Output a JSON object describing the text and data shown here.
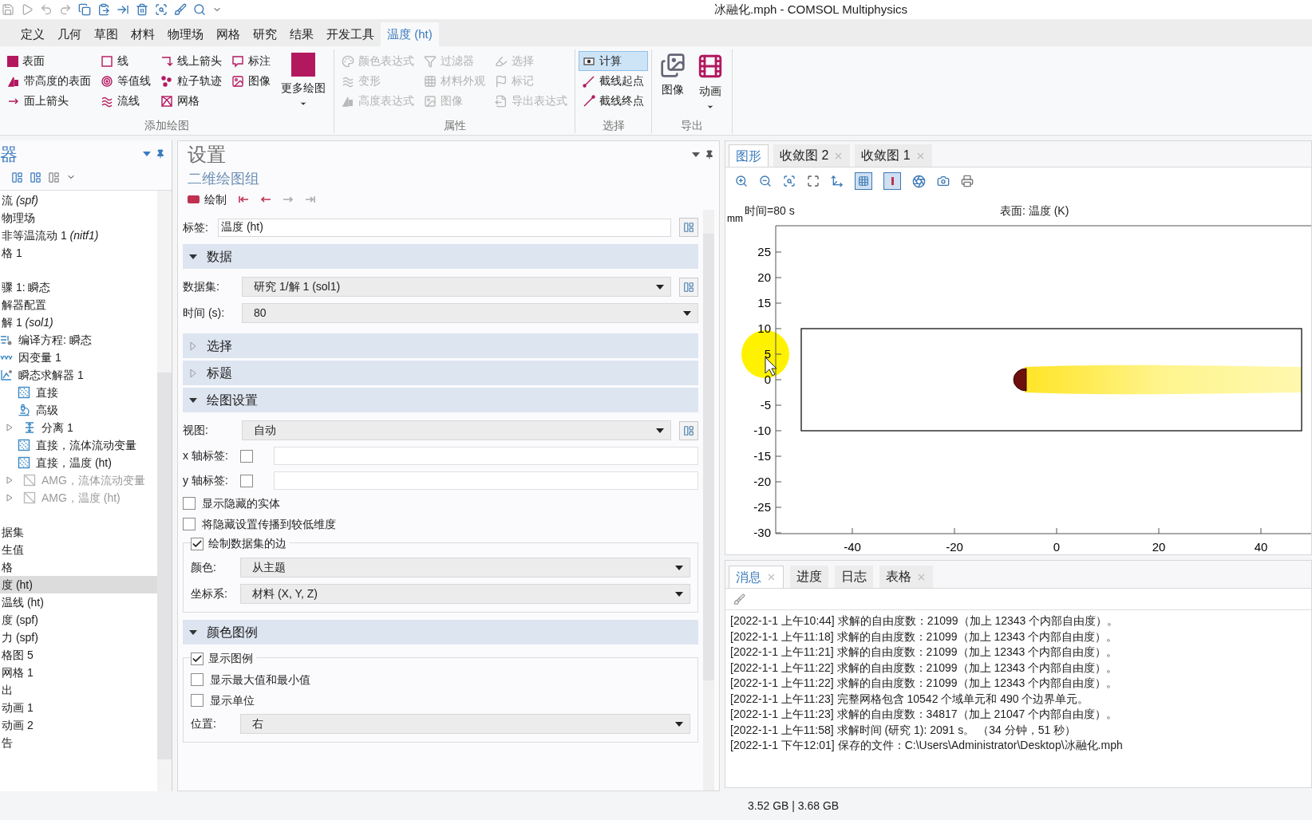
{
  "window": {
    "title": "冰融化.mph - COMSOL Multiphysics"
  },
  "menu_tabs": [
    {
      "label": "定义",
      "selected": false
    },
    {
      "label": "几何",
      "selected": false
    },
    {
      "label": "草图",
      "selected": false
    },
    {
      "label": "材料",
      "selected": false
    },
    {
      "label": "物理场",
      "selected": false
    },
    {
      "label": "网格",
      "selected": false
    },
    {
      "label": "研究",
      "selected": false
    },
    {
      "label": "结果",
      "selected": false
    },
    {
      "label": "开发工具",
      "selected": false
    },
    {
      "label": "温度 (ht)",
      "selected": true
    }
  ],
  "ribbon": {
    "groups": [
      {
        "title": "添加绘图",
        "items": [
          {
            "label": "表面",
            "kind": "small",
            "disabled": false,
            "selected": false
          },
          {
            "label": "带高度的表面",
            "kind": "small",
            "disabled": false,
            "selected": false
          },
          {
            "label": "面上箭头",
            "kind": "small",
            "disabled": false,
            "selected": false
          },
          {
            "label": "线",
            "kind": "small",
            "disabled": false,
            "selected": false
          },
          {
            "label": "等值线",
            "kind": "small",
            "disabled": false,
            "selected": false
          },
          {
            "label": "流线",
            "kind": "small",
            "disabled": false,
            "selected": false
          },
          {
            "label": "线上箭头",
            "kind": "small",
            "disabled": false,
            "selected": false
          },
          {
            "label": "粒子轨迹",
            "kind": "small",
            "disabled": false,
            "selected": false
          },
          {
            "label": "网格",
            "kind": "small",
            "disabled": false,
            "selected": false
          },
          {
            "label": "标注",
            "kind": "small",
            "disabled": false,
            "selected": false
          },
          {
            "label": "图像",
            "kind": "small",
            "disabled": false,
            "selected": false
          },
          {
            "label": "更多绘图",
            "kind": "large",
            "disabled": false,
            "selected": false
          }
        ]
      },
      {
        "title": "属性",
        "items": [
          {
            "label": "颜色表达式",
            "kind": "small",
            "disabled": true,
            "selected": false
          },
          {
            "label": "变形",
            "kind": "small",
            "disabled": true,
            "selected": false
          },
          {
            "label": "高度表达式",
            "kind": "small",
            "disabled": true,
            "selected": false
          },
          {
            "label": "过滤器",
            "kind": "small",
            "disabled": true,
            "selected": false
          },
          {
            "label": "材料外观",
            "kind": "small",
            "disabled": true,
            "selected": false
          },
          {
            "label": "图像",
            "kind": "small",
            "disabled": true,
            "selected": false
          },
          {
            "label": "选择",
            "kind": "small",
            "disabled": true,
            "selected": false
          },
          {
            "label": "标记",
            "kind": "small",
            "disabled": true,
            "selected": false
          },
          {
            "label": "导出表达式",
            "kind": "small",
            "disabled": true,
            "selected": false
          }
        ]
      },
      {
        "title": "选择",
        "items": [
          {
            "label": "计算",
            "kind": "small",
            "disabled": false,
            "selected": true
          },
          {
            "label": "截线起点",
            "kind": "small",
            "disabled": false,
            "selected": false
          },
          {
            "label": "截线终点",
            "kind": "small",
            "disabled": false,
            "selected": false
          }
        ]
      },
      {
        "title": "导出",
        "items": [
          {
            "label": "图像",
            "kind": "large",
            "disabled": false,
            "selected": false
          },
          {
            "label": "动画",
            "kind": "large",
            "disabled": false,
            "selected": false
          }
        ]
      }
    ]
  },
  "tree": {
    "title": "器",
    "groups": [
      [
        {
          "label": "流 *(spf)*",
          "selected": false
        },
        {
          "label": "物理场",
          "selected": false
        },
        {
          "label": "非等温流动 1  *(nitf1)*",
          "selected": false
        },
        {
          "label": "格 1",
          "selected": false
        }
      ],
      [
        {
          "label": "骤 1: 瞬态",
          "selected": false
        },
        {
          "label": "解器配置",
          "selected": false
        },
        {
          "label": "解 1  *(sol1)*",
          "selected": false,
          "children": [
            {
              "label": "编译方程: 瞬态",
              "kind": "equation",
              "selected": false
            },
            {
              "label": "因变量 1",
              "kind": "variable",
              "selected": false
            },
            {
              "label": "瞬态求解器 1",
              "kind": "solver",
              "selected": false,
              "children": [
                {
                  "label": "直接",
                  "kind": "direct",
                  "collapsed": false,
                  "disabled": false,
                  "selected": false
                },
                {
                  "label": "高级",
                  "kind": "advanced",
                  "collapsed": false,
                  "disabled": false,
                  "selected": false
                },
                {
                  "label": "分离 1",
                  "kind": "segregated",
                  "collapsed": true,
                  "disabled": false,
                  "selected": false
                },
                {
                  "label": "直接，流体流动变量",
                  "kind": "direct",
                  "collapsed": false,
                  "disabled": false,
                  "selected": false
                },
                {
                  "label": "直接，温度 (ht)",
                  "kind": "direct",
                  "collapsed": false,
                  "disabled": false,
                  "selected": false
                },
                {
                  "label": "AMG，流体流动变量",
                  "kind": "amg",
                  "collapsed": true,
                  "disabled": true,
                  "selected": false
                },
                {
                  "label": "AMG，温度 (ht)",
                  "kind": "amg",
                  "collapsed": true,
                  "disabled": true,
                  "selected": false
                }
              ]
            }
          ]
        }
      ],
      [
        {
          "label": "据集",
          "selected": false
        },
        {
          "label": "生值",
          "selected": false
        },
        {
          "label": "格",
          "selected": false
        },
        {
          "label": "度 (ht)",
          "selected": true
        },
        {
          "label": "温线 (ht)",
          "selected": false
        },
        {
          "label": "度 (spf)",
          "selected": false
        },
        {
          "label": "力 (spf)",
          "selected": false
        },
        {
          "label": "格图 5",
          "selected": false
        },
        {
          "label": "网格 1",
          "selected": false
        },
        {
          "label": "出",
          "selected": false
        },
        {
          "label": "动画 1",
          "selected": false
        },
        {
          "label": "动画 2",
          "selected": false
        },
        {
          "label": "告",
          "selected": false
        }
      ]
    ]
  },
  "settings": {
    "title": "设置",
    "subtitle": "二维绘图组",
    "plot_button": "绘制",
    "nav_buttons": [
      {
        "disabled": false
      },
      {
        "disabled": false
      },
      {
        "disabled": true
      },
      {
        "disabled": true
      }
    ],
    "label_field": {
      "label": "标签:",
      "value": "温度 (ht)"
    },
    "sections": [
      {
        "title": "数据",
        "expanded": true,
        "rows": [
          {
            "kind": "select",
            "label": "数据集:",
            "value": "研究 1/解 1 (sol1)",
            "button": true
          },
          {
            "kind": "select",
            "label": "时间 (s):",
            "value": "80",
            "button": false
          }
        ]
      },
      {
        "title": "选择",
        "expanded": false
      },
      {
        "title": "标题",
        "expanded": false
      },
      {
        "title": "绘图设置",
        "expanded": true,
        "rows": [
          {
            "kind": "select",
            "label": "视图:",
            "value": "自动",
            "button": true
          },
          {
            "kind": "check_input",
            "label": "x 轴标签:",
            "checked": false
          },
          {
            "kind": "check_input",
            "label": "y 轴标签:",
            "checked": false
          },
          {
            "kind": "checkbox",
            "label": "显示隐藏的实体",
            "checked": false
          },
          {
            "kind": "checkbox",
            "label": "将隐藏设置传播到较低维度",
            "checked": false
          },
          {
            "kind": "group",
            "label": "绘制数据集的边",
            "checked": true,
            "rows": [
              {
                "kind": "select",
                "label": "颜色:",
                "value": "从主题",
                "button": false
              },
              {
                "kind": "select",
                "label": "坐标系:",
                "value": "材料  (X, Y, Z)",
                "button": false
              }
            ]
          }
        ]
      },
      {
        "title": "颜色图例",
        "expanded": true,
        "rows": [
          {
            "kind": "group",
            "label": "显示图例",
            "checked": true,
            "rows": [
              {
                "kind": "checkbox",
                "label": "显示最大值和最小值",
                "checked": false
              },
              {
                "kind": "checkbox",
                "label": "显示单位",
                "checked": false
              },
              {
                "kind": "select",
                "label": "位置:",
                "value": "右",
                "button": false
              }
            ]
          }
        ]
      }
    ]
  },
  "graphics": {
    "tabs": [
      {
        "label": "图形",
        "selected": true,
        "closable": false
      },
      {
        "label": "收敛图 2",
        "selected": false,
        "closable": true
      },
      {
        "label": "收敛图 1",
        "selected": false,
        "closable": true
      }
    ],
    "plot": {
      "time_label": "时间=80 s",
      "title": "表面: 温度 (K)",
      "unit_label": "mm",
      "yticks": [
        "25",
        "20",
        "15",
        "10",
        "5",
        "0",
        "-5",
        "-10",
        "-15",
        "-20",
        "-25",
        "-30"
      ],
      "xticks": [
        "-40",
        "-20",
        "0",
        "20",
        "40"
      ]
    }
  },
  "messages": {
    "tabs": [
      {
        "label": "消息",
        "selected": true,
        "closable": true
      },
      {
        "label": "进度",
        "selected": false,
        "closable": false
      },
      {
        "label": "日志",
        "selected": false,
        "closable": false
      },
      {
        "label": "表格",
        "selected": false,
        "closable": true
      }
    ],
    "lines": [
      "[2022-1-1 上午10:44] 求解的自由度数：21099（加上 12343 个内部自由度）。",
      "[2022-1-1 上午11:18] 求解的自由度数：21099（加上 12343 个内部自由度）。",
      "[2022-1-1 上午11:21] 求解的自由度数：21099（加上 12343 个内部自由度）。",
      "[2022-1-1 上午11:22] 求解的自由度数：21099（加上 12343 个内部自由度）。",
      "[2022-1-1 上午11:22] 求解的自由度数：21099（加上 12343 个内部自由度）。",
      "[2022-1-1 上午11:23] 完整网格包含 10542 个域单元和 490 个边界单元。",
      "[2022-1-1 上午11:23] 求解的自由度数：34817（加上 21047 个内部自由度）。",
      "[2022-1-1 上午11:58] 求解时间 (研究 1): 2091 s。  （34 分钟，51 秒）",
      "[2022-1-1 下午12:01] 保存的文件：C:\\Users\\Administrator\\Desktop\\冰融化.mph"
    ]
  },
  "status_bar": {
    "memory": "3.52 GB | 3.68 GB"
  }
}
